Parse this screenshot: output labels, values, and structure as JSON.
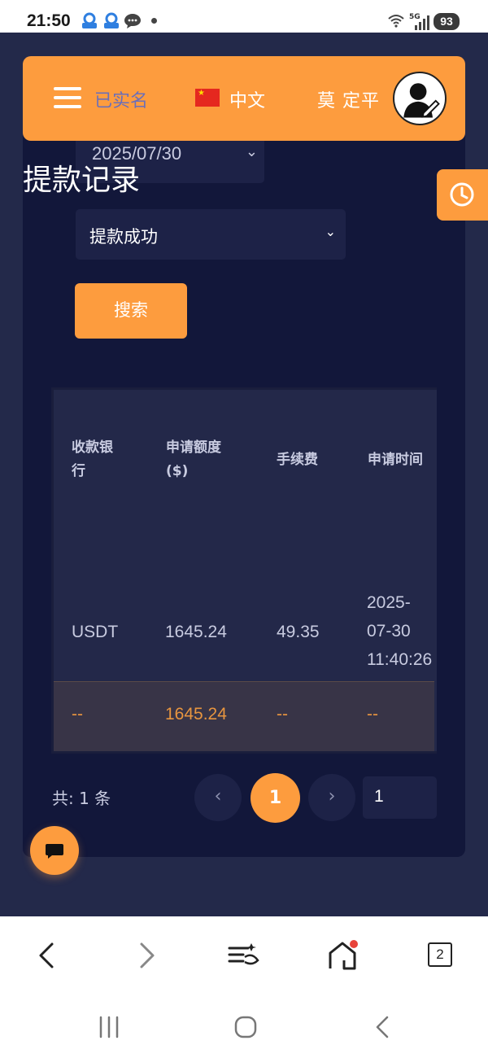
{
  "status_bar": {
    "time": "21:50",
    "network": "5G",
    "battery": "93"
  },
  "header": {
    "verification": "已实名",
    "language": "中文",
    "username": "莫 定平"
  },
  "filters": {
    "date": "2025/07/30",
    "status": "提款成功",
    "search_label": "搜索"
  },
  "page_title": "提款记录",
  "table": {
    "columns": [
      "收款银行",
      "申请额度($)",
      "手续费",
      "申请时间"
    ],
    "column_display": [
      [
        "收款银",
        "行"
      ],
      [
        "申请额度",
        "($)"
      ],
      [
        "手续费"
      ],
      [
        "申请时间"
      ]
    ],
    "rows": [
      {
        "bank": "USDT",
        "amount": "1645.24",
        "fee": "49.35",
        "time_lines": [
          "2025-",
          "07-30",
          "11:40:26"
        ]
      }
    ],
    "totals": {
      "bank": "--",
      "amount": "1645.24",
      "fee": "--",
      "time": "--"
    }
  },
  "pagination": {
    "total": "共: 1 条",
    "prev": "‹",
    "current": "1",
    "next": "›",
    "page_input": "1"
  },
  "browser_tabs_count": "2",
  "colors": {
    "accent": "#fd9c3e",
    "background": "#23294a",
    "panel": "#12173a",
    "table": "#232849",
    "total_text": "#e8953f"
  },
  "icons": [
    "menu-icon",
    "china-flag-icon",
    "avatar-icon",
    "clock-icon",
    "chevron-down-icon",
    "chat-icon",
    "back-icon",
    "forward-icon",
    "reader-icon",
    "home-icon",
    "tabs-icon",
    "recent-apps-icon",
    "home-button-icon",
    "system-back-icon"
  ]
}
